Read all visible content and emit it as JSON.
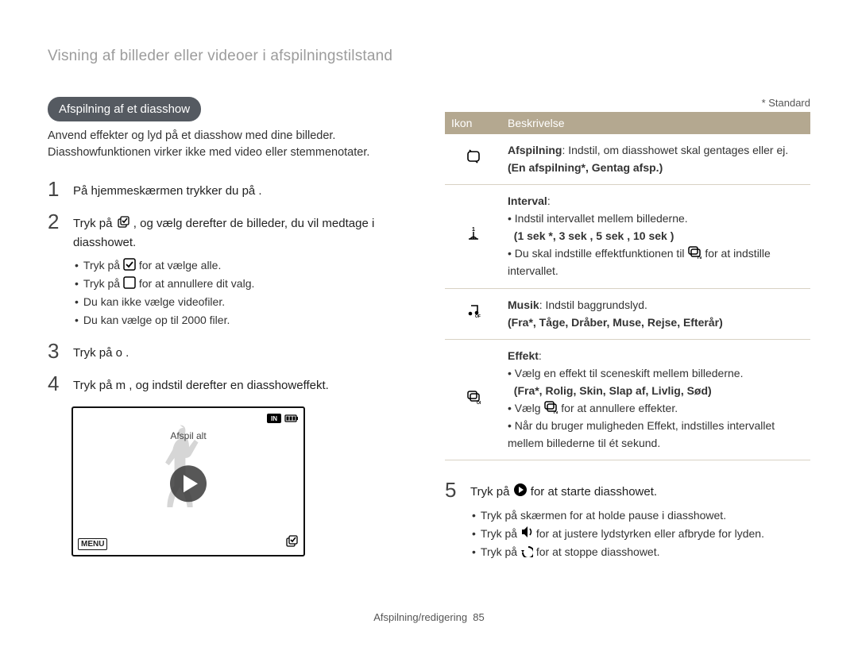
{
  "breadcrumb": "Visning af billeder eller videoer i afspilningstilstand",
  "section_title": "Afspilning af et diasshow",
  "intro_lines": [
    "Anvend effekter og lyd på et diasshow med dine billeder.",
    "Diasshowfunktionen virker ikke med video eller stemmenotater."
  ],
  "steps": {
    "s1": {
      "num": "1",
      "text": "På hjemmeskærmen trykker du på ."
    },
    "s2": {
      "num": "2",
      "text_a": "Tryk på ",
      "text_b": ", og vælg derefter de billeder, du vil medtage i diasshowet.",
      "subs": {
        "a": {
          "pre": "Tryk på ",
          "post": " for at vælge alle."
        },
        "b": {
          "pre": "Tryk på ",
          "post": " for at annullere dit valg."
        },
        "c": "Du kan ikke vælge videofiler.",
        "d": "Du kan vælge op til 2000 filer."
      }
    },
    "s3": {
      "num": "3",
      "text": "Tryk på o ."
    },
    "s4": {
      "num": "4",
      "text": "Tryk på m , og indstil derefter en diasshoweffekt."
    },
    "s5": {
      "num": "5",
      "text_a": "Tryk på ",
      "text_b": " for at starte diasshowet.",
      "subs": {
        "a": "Tryk på skærmen for at holde pause i diasshowet.",
        "b": {
          "pre": "Tryk på ",
          "post": " for at justere lydstyrken eller afbryde for lyden."
        },
        "c": {
          "pre": "Tryk på ",
          "post": " for at stoppe diasshowet."
        }
      }
    }
  },
  "preview": {
    "caption": "Afspil alt",
    "menu": "MENU"
  },
  "standard_note": "* Standard",
  "table": {
    "head": {
      "icon": "Ikon",
      "desc": "Beskrivelse"
    },
    "rows": {
      "r1": {
        "title": "Afspilning",
        "text": ": Indstil, om diasshowet skal gentages eller ej.",
        "options": "(En afspilning*, Gentag afsp.)"
      },
      "r2": {
        "title": "Interval",
        "lines": {
          "a": "Indstil intervallet mellem billederne.",
          "b": "(1 sek *, 3 sek , 5 sek , 10 sek )",
          "c_pre": "Du skal indstille effektfunktionen til ",
          "c_post": " for at indstille intervallet."
        }
      },
      "r3": {
        "title": "Musik",
        "text": ": Indstil baggrundslyd.",
        "options": "(Fra*, Tåge, Dråber, Muse, Rejse, Efterår)"
      },
      "r4": {
        "title": "Effekt",
        "lines": {
          "a": "Vælg en effekt til sceneskift mellem billederne.",
          "b": "(Fra*, Rolig, Skin, Slap af, Livlig, Sød)",
          "c_pre": "Vælg ",
          "c_post": " for at annullere effekter.",
          "d": "Når du bruger muligheden Effekt, indstilles intervallet mellem billederne til ét sekund."
        }
      }
    }
  },
  "footer": {
    "section": "Afspilning/redigering",
    "page": "85"
  }
}
